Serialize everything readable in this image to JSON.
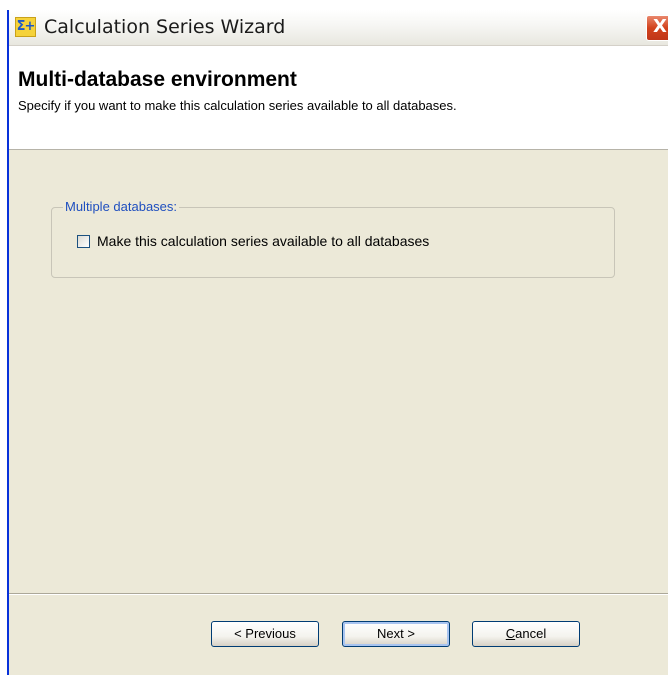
{
  "window": {
    "title": "Calculation Series Wizard",
    "close_symbol": "X",
    "app_icon": "sigma-plus-icon",
    "app_icon_text": "Σ+"
  },
  "header": {
    "title": "Multi-database environment",
    "subtitle": "Specify if you want to make this calculation series available to all databases."
  },
  "group": {
    "legend": "Multiple databases:",
    "checkbox_label": "Make this calculation series available to all databases",
    "checked": false
  },
  "buttons": {
    "previous": "< Previous",
    "next": "Next >",
    "cancel_underlined": "C",
    "cancel_rest": "ancel"
  },
  "colors": {
    "dialog_background": "#ece9d8",
    "legend_text": "#1f4fbf",
    "close_button": "#d2421c"
  }
}
